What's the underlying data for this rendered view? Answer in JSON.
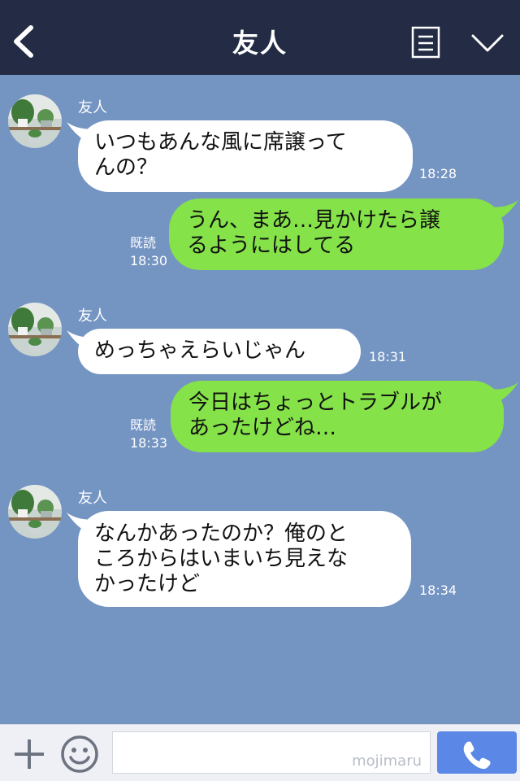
{
  "header": {
    "title": "友人"
  },
  "messages": [
    {
      "sender": "友人",
      "text": "いつもあんな風に席譲って\nんの？",
      "time": "18:28"
    },
    {
      "text": "うん、まあ…見かけたら譲\nるようにはしてる",
      "read": "既読",
      "time": "18:30"
    },
    {
      "sender": "友人",
      "text": "めっちゃえらいじゃん",
      "time": "18:31"
    },
    {
      "text": "今日はちょっとトラブルが\nあったけどね…",
      "read": "既読",
      "time": "18:33"
    },
    {
      "sender": "友人",
      "text": "なんかあったのか？俺のと\nころからはいまいち見えな\nかったけど",
      "time": "18:34"
    }
  ],
  "footer": {
    "input_value": "",
    "watermark": "mojimaru"
  },
  "colors": {
    "header_bg": "#232b45",
    "chat_bg": "#7494c2",
    "incoming_bubble": "#ffffff",
    "outgoing_bubble": "#85e249",
    "call_button": "#5b87e6"
  }
}
